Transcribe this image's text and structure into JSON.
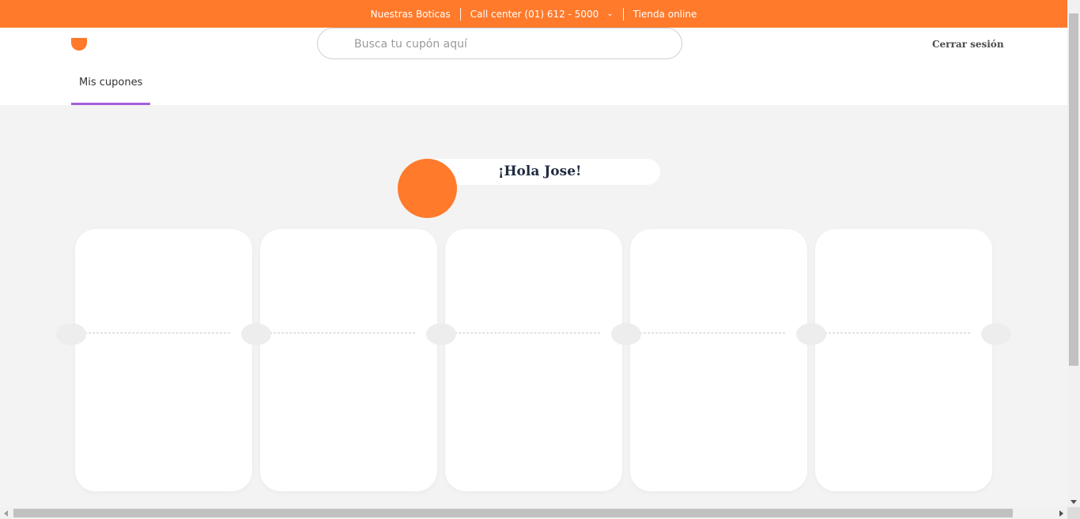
{
  "topbar": {
    "links": {
      "stores": "Nuestras Boticas",
      "call_center": "Call center (01) 612 - 5000",
      "online_store": "Tienda online"
    },
    "chevron_icon": "chevron-down-icon",
    "background_color": "#ff7a2b"
  },
  "header": {
    "search_placeholder": "Busca tu cupón aquí",
    "search_value": "",
    "logout_label": "Cerrar sesión"
  },
  "nav": {
    "tabs": [
      {
        "label": "Mis cupones",
        "active": true
      }
    ],
    "active_indicator_color": "#a35fdc"
  },
  "greeting": {
    "text": "¡Hola Jose!",
    "avatar_color": "#ff7a2b"
  },
  "coupons": {
    "cards": [
      {},
      {},
      {},
      {},
      {}
    ]
  },
  "colors": {
    "brand": "#ff7a2b",
    "page_background": "#f3f3f3",
    "card_background": "#ffffff",
    "greeting_text": "#1f2b3f"
  }
}
